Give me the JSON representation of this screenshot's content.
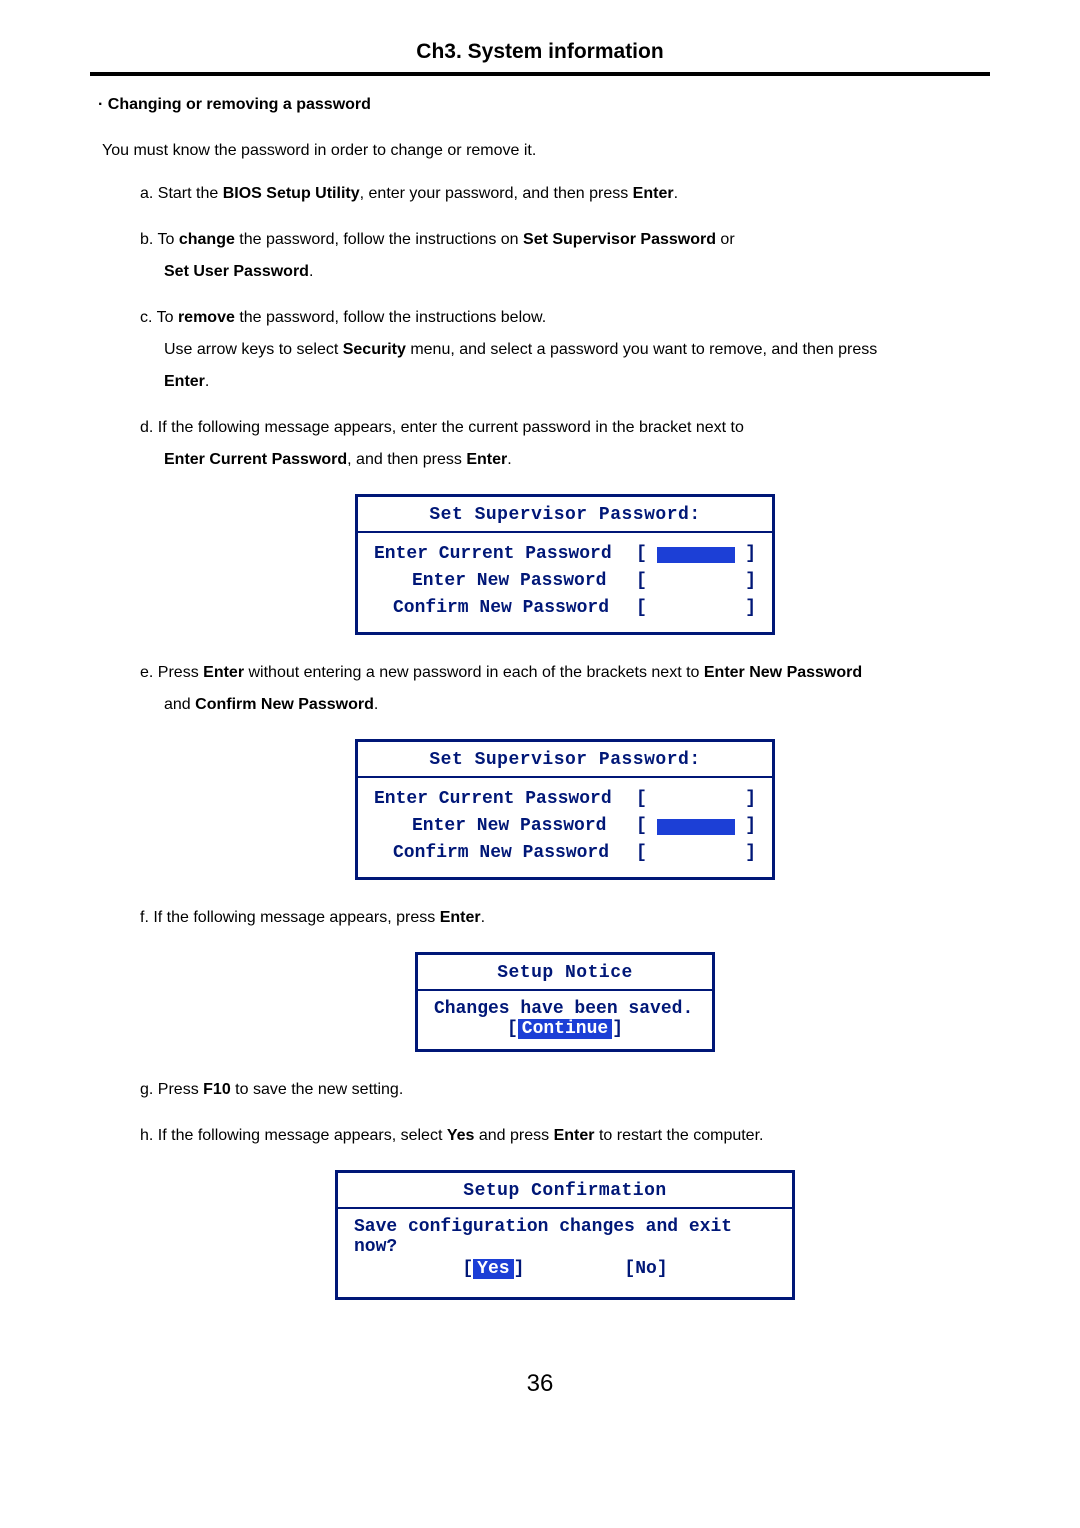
{
  "chapter_title": "Ch3. System information",
  "section_heading": "· Changing  or removing a password",
  "intro": "You must know the password in order to change or remove it.",
  "step_a_prefix": "a. Start the ",
  "step_a_bold1": "BIOS Setup Utility",
  "step_a_mid": ", enter your password, and then press ",
  "step_a_bold2": "Enter",
  "step_a_end": ".",
  "step_b_prefix": "b. To ",
  "step_b_bold1": "change",
  "step_b_mid": " the password, follow the instructions on ",
  "step_b_bold2": "Set Supervisor Password",
  "step_b_end": " or",
  "step_b_line2_bold": "Set User Password",
  "step_b_line2_end": ".",
  "step_c_prefix": "c. To ",
  "step_c_bold1": "remove",
  "step_c_end1": " the password, follow the instructions below.",
  "step_c_line2_prefix": "Use arrow keys to select ",
  "step_c_line2_bold": "Security",
  "step_c_line2_end": " menu, and select a password you want to remove, and then press",
  "step_c_line3_bold": "Enter",
  "step_c_line3_end": ".",
  "step_d_line1": "d. If the following message appears, enter the current password in the bracket next to",
  "step_d_line2_bold": "Enter Current Password",
  "step_d_line2_mid": ", and then press ",
  "step_d_line2_bold2": "Enter",
  "step_d_line2_end": ".",
  "dialog1_title": "Set Supervisor Password:",
  "dialog_row1": "Enter Current Password",
  "dialog_row2": "Enter New Password",
  "dialog_row3": "Confirm New Password",
  "step_e_prefix": "e. Press ",
  "step_e_bold1": "Enter",
  "step_e_mid": " without entering a new password in each of the brackets next to ",
  "step_e_bold2": "Enter New Password",
  "step_e_line2_prefix": "and ",
  "step_e_line2_bold": "Confirm New Password",
  "step_e_line2_end": ".",
  "dialog2_title": "Set Supervisor Password:",
  "step_f_prefix": "f. If the following message appears, press ",
  "step_f_bold": "Enter",
  "step_f_end": ".",
  "dialog3_title": "Setup Notice",
  "dialog3_line1": "Changes have been saved.",
  "dialog3_button": "Continue",
  "step_g_prefix": "g. Press ",
  "step_g_bold": "F10",
  "step_g_end": " to save the new setting.",
  "step_h_prefix": "h. If the following message appears, select ",
  "step_h_bold1": "Yes",
  "step_h_mid": " and press ",
  "step_h_bold2": "Enter",
  "step_h_end": " to restart the computer.",
  "dialog4_title": "Setup Confirmation",
  "dialog4_line1": "Save configuration changes and exit now?",
  "dialog4_yes": "Yes",
  "dialog4_no": "No",
  "pagenum": "36"
}
